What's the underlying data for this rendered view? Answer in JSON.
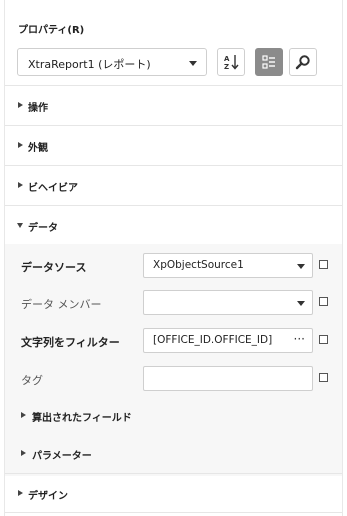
{
  "panel": {
    "title": "プロパティ(R)",
    "report_selector": {
      "value": "XtraReport1 (レポート)"
    },
    "toolbar": {
      "sort_icon": "sort-alphabetical-icon",
      "categorize_icon": "categorized-view-icon",
      "search_icon": "search-icon"
    }
  },
  "sections": [
    {
      "label": "操作",
      "expanded": false
    },
    {
      "label": "外観",
      "expanded": false
    },
    {
      "label": "ビヘイビア",
      "expanded": false
    },
    {
      "label": "データ",
      "expanded": true
    }
  ],
  "data_properties": [
    {
      "label": "データソース",
      "value": "XpObjectSource1",
      "editor": "dropdown",
      "bold": true
    },
    {
      "label": "データ メンバー",
      "value": "",
      "editor": "dropdown",
      "bold": false
    },
    {
      "label": "文字列をフィルター",
      "value": "[OFFICE_ID.OFFICE_ID] ...",
      "editor": "ellipsis",
      "bold": true
    },
    {
      "label": "タグ",
      "value": "",
      "editor": "text",
      "bold": false
    }
  ],
  "subgroups": [
    {
      "label": "算出されたフィールド"
    },
    {
      "label": "パラメーター"
    }
  ],
  "last_section": {
    "label": "デザイン",
    "expanded": false
  },
  "colors": {
    "active_button": "#8b8b8b",
    "data_body_bg": "#f7f7f7"
  }
}
